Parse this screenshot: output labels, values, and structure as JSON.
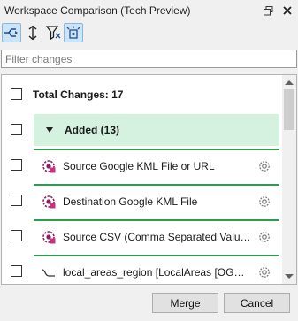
{
  "window": {
    "title": "Workspace Comparison (Tech Preview)",
    "float_icon": "float-icon",
    "close_icon": "close-icon"
  },
  "toolbar": {
    "tools": [
      {
        "name": "compare-flow-icon",
        "active": true
      },
      {
        "name": "sort-vertical-icon",
        "active": false
      },
      {
        "name": "filter-icon",
        "active": false
      },
      {
        "name": "select-target-icon",
        "active": true
      }
    ]
  },
  "filter": {
    "placeholder": "Filter changes",
    "value": ""
  },
  "summary": {
    "total_label": "Total Changes: 17"
  },
  "group": {
    "label": "Added (13)",
    "color": "#d5f1df"
  },
  "items": [
    {
      "label": "Source Google KML File or URL",
      "icon": "fme-parameter-icon"
    },
    {
      "label": "Destination Google KML File",
      "icon": "fme-parameter-icon"
    },
    {
      "label": "Source CSV (Comma Separated Value) ...",
      "icon": "fme-parameter-icon"
    },
    {
      "label": "local_areas_region [LocalAreas [OGCK...",
      "icon": "feature-type-icon"
    }
  ],
  "accent": "#2e9a4f",
  "buttons": {
    "merge": "Merge",
    "cancel": "Cancel"
  }
}
